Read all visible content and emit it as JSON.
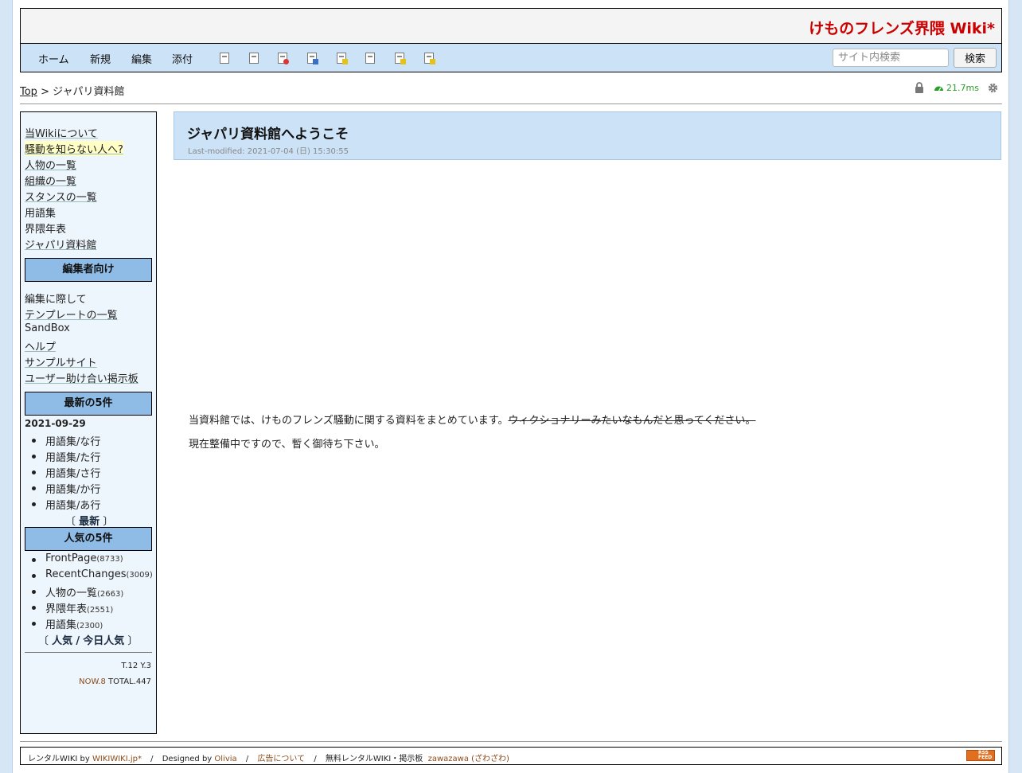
{
  "header": {
    "site_title": "けものフレンズ界隈 Wiki*"
  },
  "nav": {
    "items": [
      "ホーム",
      "新規",
      "編集",
      "添付"
    ],
    "tool_icons": [
      "copy-page-icon",
      "diff-icon",
      "delete-icon",
      "save-icon",
      "folder-icon",
      "pages-icon",
      "new-page-icon",
      "help-icon"
    ],
    "search_placeholder": "サイト内検索",
    "search_button": "検索"
  },
  "breadcrumb": {
    "top": "Top",
    "sep": ">",
    "current": "ジャパリ資料館"
  },
  "status": {
    "load_time": "21.7ms"
  },
  "sidebar": {
    "main_links": [
      "当Wikiについて",
      "騒動を知らない人へ?",
      "人物の一覧",
      "組織の一覧",
      "スタンスの一覧",
      "用語集",
      "界隈年表",
      "ジャパリ資料館"
    ],
    "editor_heading": "編集者向け",
    "editor_links": [
      "編集に際して",
      "テンプレートの一覧",
      "SandBox",
      "ヘルプ",
      "サンプルサイト",
      "ユーザー助け合い掲示板"
    ],
    "recent_heading": "最新の5件",
    "recent_date": "2021-09-29",
    "recent_items": [
      "用語集/な行",
      "用語集/た行",
      "用語集/さ行",
      "用語集/か行",
      "用語集/あ行"
    ],
    "recent_more_left": "〔",
    "recent_more": "最新",
    "recent_more_right": "〕",
    "popular_heading": "人気の5件",
    "popular_items": [
      {
        "name": "FrontPage",
        "count": "(8733)"
      },
      {
        "name": "RecentChanges",
        "count": "(3009)"
      },
      {
        "name": "人物の一覧",
        "count": "(2663)"
      },
      {
        "name": "界隈年表",
        "count": "(2551)"
      },
      {
        "name": "用語集",
        "count": "(2300)"
      }
    ],
    "popular_more_left": "〔",
    "popular_more_a": "人気",
    "popular_more_sep": "/",
    "popular_more_b": "今日人気",
    "popular_more_right": "〕",
    "counter_line1": "T.12 Y.3",
    "counter_now": "NOW.8",
    "counter_total": "TOTAL.447"
  },
  "content": {
    "title": "ジャパリ資料館へようこそ",
    "last_modified": "Last-modified: 2021-07-04 (日) 15:30:55",
    "para1_main": "当資料館では、けものフレンズ騒動に関する資料をまとめています。",
    "para1_strike": "ウィクショナリーみたいなもんだと思ってください。",
    "para2": "現在整備中ですので、暫く御待ち下さい。"
  },
  "footer": {
    "rental_label": "レンタルWIKI by",
    "rental_link": "WIKIWIKI.jp*",
    "sep": "/",
    "designed_label": "Designed by",
    "designed_link": "Olivia",
    "ads_link": "広告について",
    "free_label": "無料レンタルWIKI・掲示板",
    "zawazawa_link": "zawazawa (ざわざわ)",
    "rss_label": "RSS FEED"
  }
}
